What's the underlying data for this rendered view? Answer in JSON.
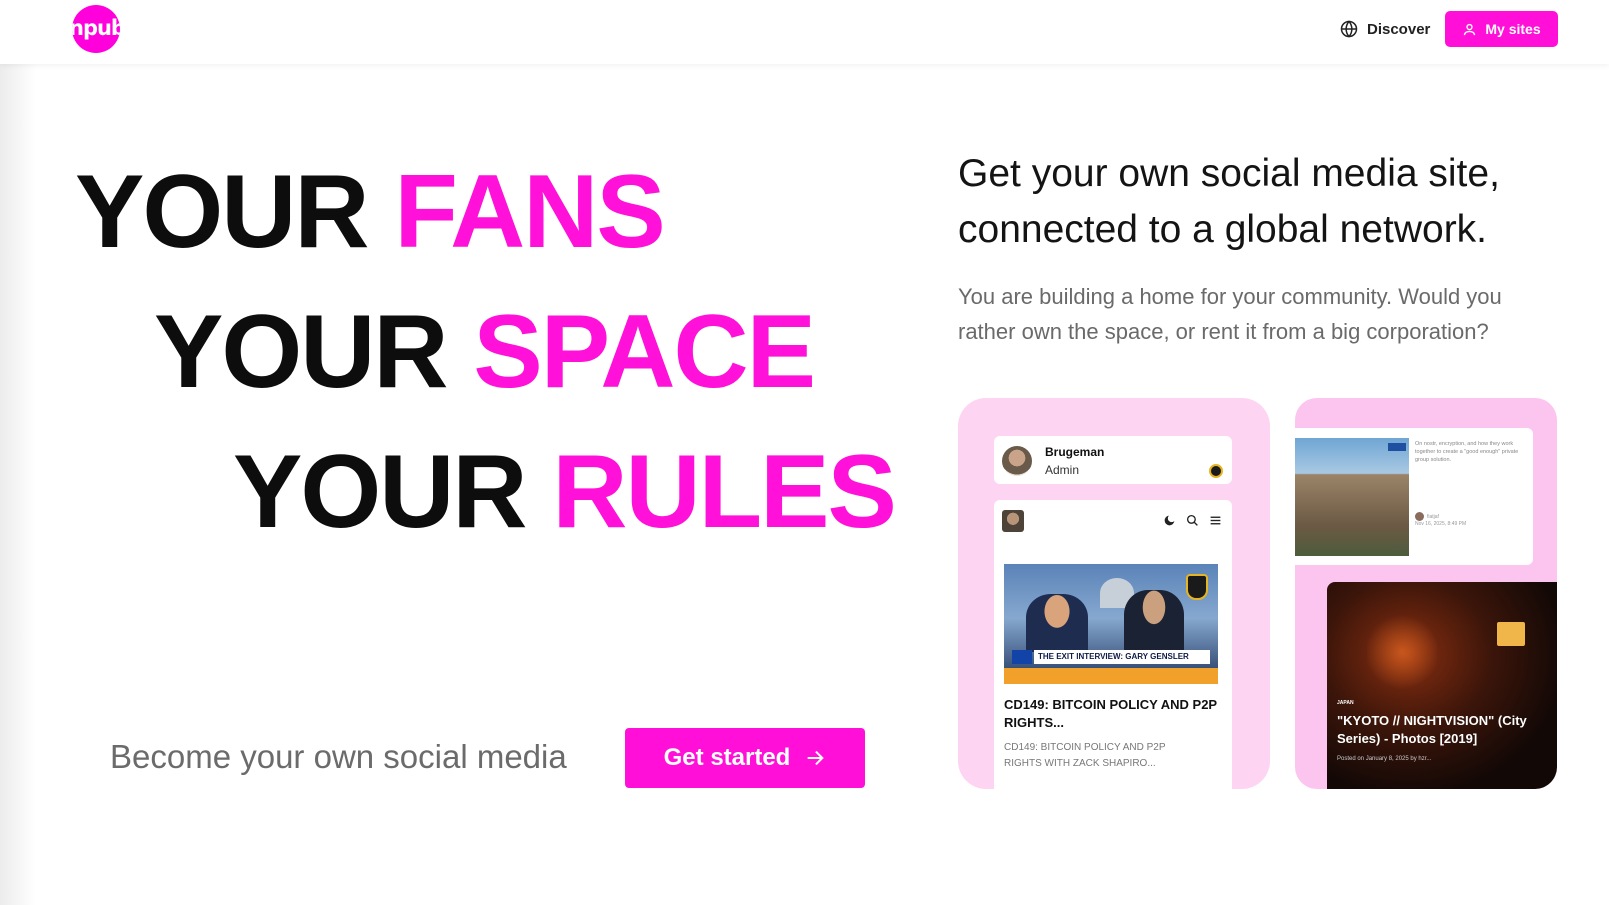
{
  "header": {
    "logo_text": "npub",
    "discover_label": "Discover",
    "my_sites_label": "My sites"
  },
  "hero": {
    "lines": [
      {
        "black": "YOUR",
        "pink": "FANS"
      },
      {
        "black": "YOUR",
        "pink": "SPACE"
      },
      {
        "black": "YOUR",
        "pink": "RULES"
      }
    ],
    "tagline": "Become your own social media",
    "cta_label": "Get started"
  },
  "intro": {
    "title": "Get your own social media site, connected to a global network.",
    "description": "You are building a home for your community. Would you rather own the space, or rent it from a big corporation?"
  },
  "preview_card_1": {
    "admin_name": "Brugeman",
    "admin_role": "Admin",
    "thumb_banner": "THE EXIT INTERVIEW: GARY GENSLER",
    "post_title": "CD149: BITCOIN POLICY AND P2P RIGHTS...",
    "post_desc": "CD149: BITCOIN POLICY AND P2P RIGHTS WITH ZACK SHAPIRO..."
  },
  "preview_card_2": {
    "post_text": "On nostr, encryption, and how they work together to create a \"good enough\" private group solution.",
    "post_author": "fiatjaf",
    "post_date": "Nov 16, 2025, 8:49 PM",
    "night_tag": "JAPAN",
    "night_title": "\"KYOTO // NIGHTVISION\" (City Series) - Photos [2019]",
    "night_meta": "Posted on January 8, 2025 by hzr..."
  },
  "colors": {
    "brand_pink": "#ff0fd8",
    "card1_bg": "#fdd5f3",
    "card2_bg": "#fcc5ef"
  }
}
